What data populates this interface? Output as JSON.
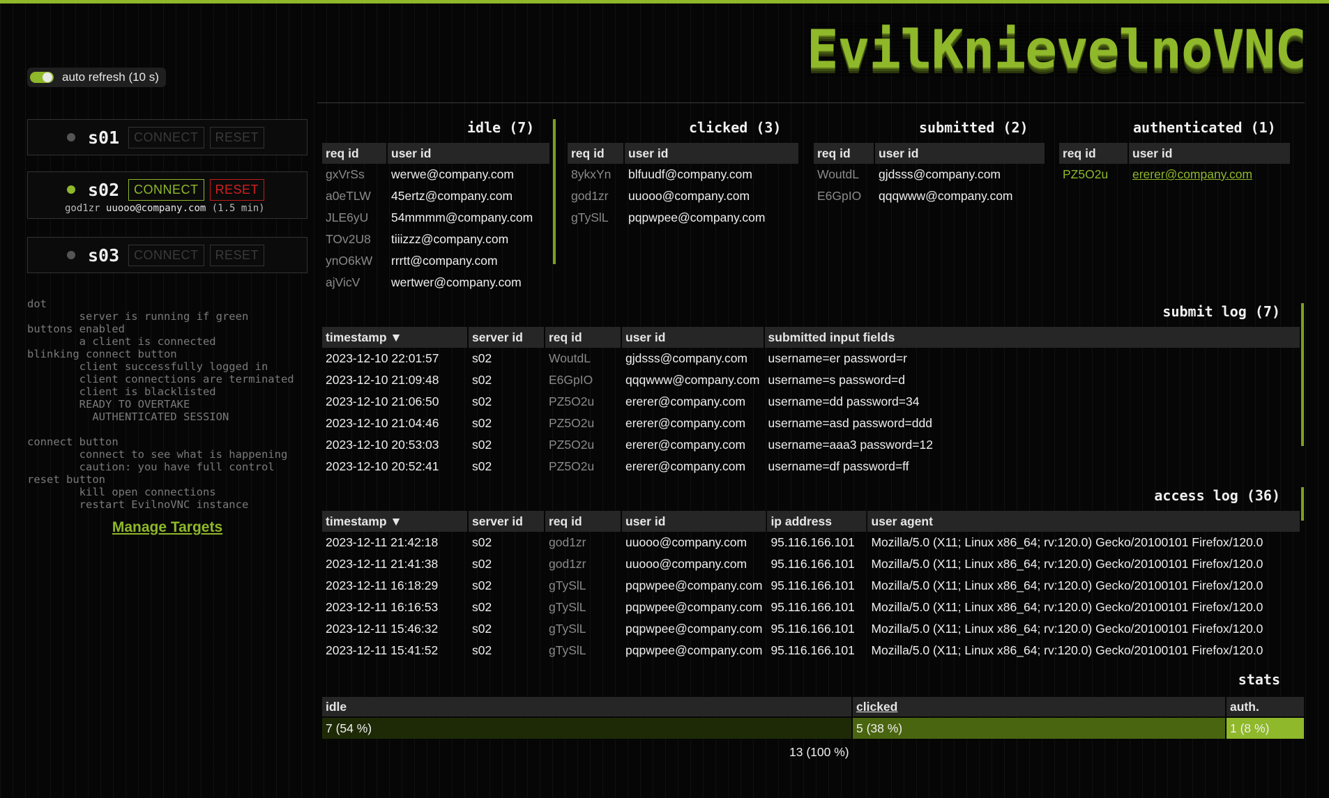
{
  "app": {
    "logo": "EvilKnievelnoVNC"
  },
  "controls": {
    "auto_refresh_label": "auto refresh (10 s)",
    "auto_refresh_on": true
  },
  "servers": [
    {
      "id": "s01",
      "active": false,
      "connect_label": "CONNECT",
      "reset_label": "RESET"
    },
    {
      "id": "s02",
      "active": true,
      "connect_label": "CONNECT",
      "reset_label": "RESET",
      "session_req": "god1zr",
      "session_user": "uuooo@company.com",
      "session_duration": "(1.5 min)"
    },
    {
      "id": "s03",
      "active": false,
      "connect_label": "CONNECT",
      "reset_label": "RESET"
    }
  ],
  "legend": {
    "text": "dot\n        server is running if green\nbuttons enabled\n        a client is connected\nblinking connect button\n        client successfully logged in\n        client connections are terminated\n        client is blacklisted\n        READY TO OVERTAKE\n          AUTHENTICATED SESSION\n\nconnect button\n        connect to see what is happening\n        caution: you have full control\nreset button\n        kill open connections\n        restart EvilnoVNC instance"
  },
  "manage_link": "Manage Targets",
  "pipeline": {
    "headers": {
      "req": "req id",
      "user": "user id"
    },
    "idle": {
      "title": "idle (7)",
      "rows": [
        [
          "gxVrSs",
          "werwe@company.com"
        ],
        [
          "a0eTLW",
          "45ertz@company.com"
        ],
        [
          "JLE6yU",
          "54mmmm@company.com"
        ],
        [
          "TOv2U8",
          "tiiizzz@company.com"
        ],
        [
          "ynO6kW",
          "rrrtt@company.com"
        ],
        [
          "ajVicV",
          "wertwer@company.com"
        ]
      ]
    },
    "clicked": {
      "title": "clicked (3)",
      "rows": [
        [
          "8ykxYn",
          "blfuudf@company.com"
        ],
        [
          "god1zr",
          "uuooo@company.com"
        ],
        [
          "gTySlL",
          "pqpwpee@company.com"
        ]
      ]
    },
    "submitted": {
      "title": "submitted (2)",
      "rows": [
        [
          "WoutdL",
          "gjdsss@company.com"
        ],
        [
          "E6GpIO",
          "qqqwww@company.com"
        ]
      ]
    },
    "authenticated": {
      "title": "authenticated (1)",
      "rows": [
        [
          "PZ5O2u",
          "ererer@company.com"
        ]
      ]
    }
  },
  "submit_log": {
    "title": "submit log (7)",
    "headers": [
      "timestamp ▼",
      "server id",
      "req id",
      "user id",
      "submitted input fields"
    ],
    "rows": [
      [
        "2023-12-10 22:01:57",
        "s02",
        "WoutdL",
        "gjdsss@company.com",
        "username=er password=r"
      ],
      [
        "2023-12-10 21:09:48",
        "s02",
        "E6GpIO",
        "qqqwww@company.com",
        "username=s password=d"
      ],
      [
        "2023-12-10 21:06:50",
        "s02",
        "PZ5O2u",
        "ererer@company.com",
        "username=dd password=34"
      ],
      [
        "2023-12-10 21:04:46",
        "s02",
        "PZ5O2u",
        "ererer@company.com",
        "username=asd password=ddd"
      ],
      [
        "2023-12-10 20:53:03",
        "s02",
        "PZ5O2u",
        "ererer@company.com",
        "username=aaa3 password=12"
      ],
      [
        "2023-12-10 20:52:41",
        "s02",
        "PZ5O2u",
        "ererer@company.com",
        "username=df password=ff"
      ]
    ]
  },
  "access_log": {
    "title": "access log (36)",
    "headers": [
      "timestamp ▼",
      "server id",
      "req id",
      "user id",
      "ip address",
      "user agent"
    ],
    "rows": [
      [
        "2023-12-11 21:42:18",
        "s02",
        "god1zr",
        "uuooo@company.com",
        "95.116.166.101",
        "Mozilla/5.0 (X11; Linux x86_64; rv:120.0) Gecko/20100101 Firefox/120.0"
      ],
      [
        "2023-12-11 21:41:38",
        "s02",
        "god1zr",
        "uuooo@company.com",
        "95.116.166.101",
        "Mozilla/5.0 (X11; Linux x86_64; rv:120.0) Gecko/20100101 Firefox/120.0"
      ],
      [
        "2023-12-11 16:18:29",
        "s02",
        "gTySlL",
        "pqpwpee@company.com",
        "95.116.166.101",
        "Mozilla/5.0 (X11; Linux x86_64; rv:120.0) Gecko/20100101 Firefox/120.0"
      ],
      [
        "2023-12-11 16:16:53",
        "s02",
        "gTySlL",
        "pqpwpee@company.com",
        "95.116.166.101",
        "Mozilla/5.0 (X11; Linux x86_64; rv:120.0) Gecko/20100101 Firefox/120.0"
      ],
      [
        "2023-12-11 15:46:32",
        "s02",
        "gTySlL",
        "pqpwpee@company.com",
        "95.116.166.101",
        "Mozilla/5.0 (X11; Linux x86_64; rv:120.0) Gecko/20100101 Firefox/120.0"
      ],
      [
        "2023-12-11 15:41:52",
        "s02",
        "gTySlL",
        "pqpwpee@company.com",
        "95.116.166.101",
        "Mozilla/5.0 (X11; Linux x86_64; rv:120.0) Gecko/20100101 Firefox/120.0"
      ]
    ]
  },
  "stats": {
    "title": "stats",
    "segments": [
      {
        "label": "idle",
        "value": "7 (54 %)",
        "fraction": 0.54,
        "color": "#1e2a06",
        "link": false
      },
      {
        "label": "clicked",
        "value": "5 (38 %)",
        "fraction": 0.38,
        "color": "#4a650f",
        "link": true
      },
      {
        "label": "auth.",
        "value": "1 (8 %)",
        "fraction": 0.08,
        "color": "#8fb82a",
        "link": false
      }
    ],
    "total": "13 (100 %)"
  }
}
